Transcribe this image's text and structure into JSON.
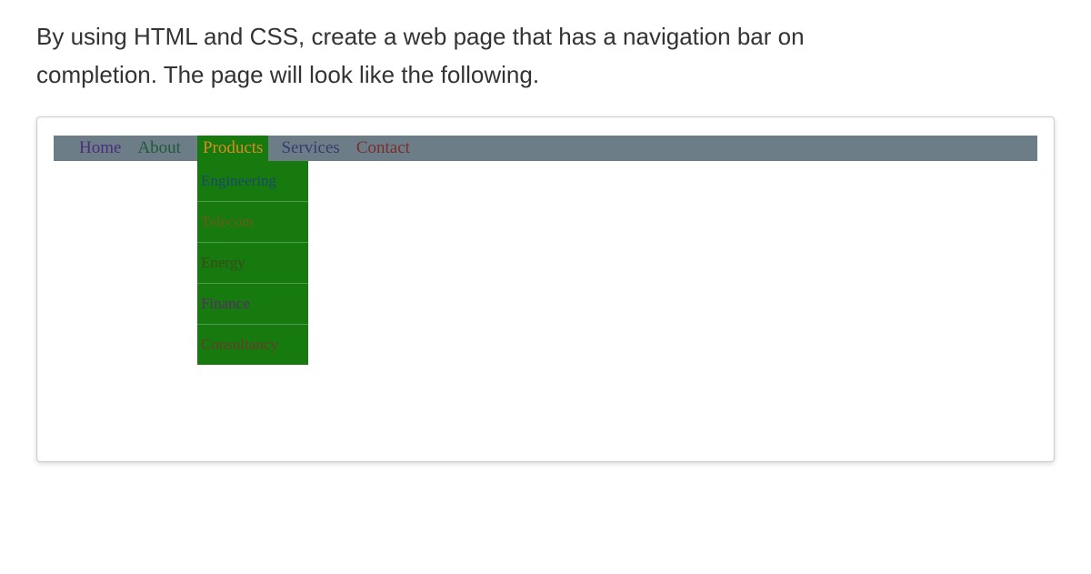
{
  "instruction": {
    "line1": "By using HTML and CSS, create a web page that has a navigation bar on",
    "line2": "completion. The page will look like the following."
  },
  "nav": {
    "home": "Home",
    "about": "About",
    "products": "Products",
    "services": "Services",
    "contact": "Contact"
  },
  "dropdown": {
    "engineering": "Engineering",
    "telecom": "Telecom",
    "energy": "Energy",
    "finance": "Finance",
    "consultancy": "Consultancy"
  }
}
